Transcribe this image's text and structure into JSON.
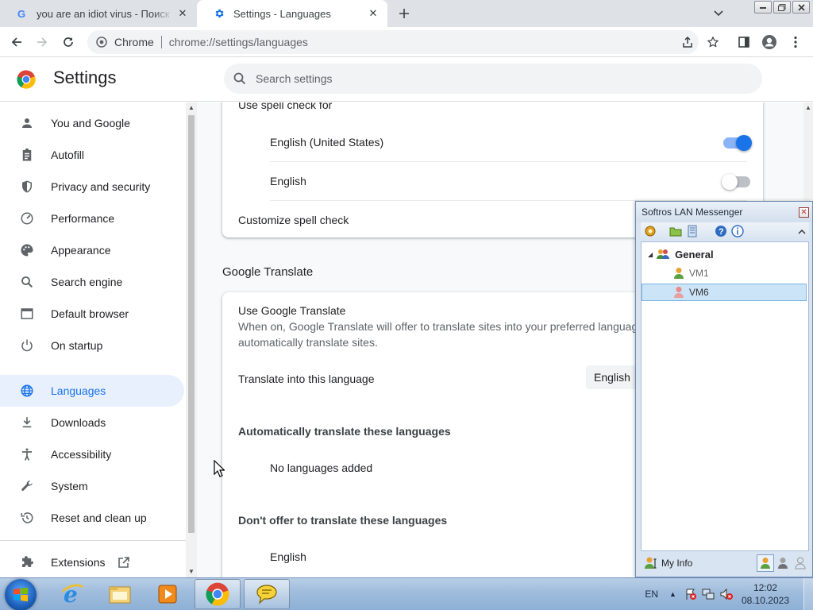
{
  "browser": {
    "tabs": [
      {
        "title": "you are an idiot virus - Поиск в Google",
        "favicon": "google-icon",
        "active": false
      },
      {
        "title": "Settings - Languages",
        "favicon": "gear-icon",
        "active": true
      }
    ],
    "omnibox": {
      "origin": "Chrome",
      "url": "chrome://settings/languages"
    }
  },
  "settings": {
    "title": "Settings",
    "search_placeholder": "Search settings",
    "nav": [
      {
        "label": "You and Google",
        "icon": "person-icon"
      },
      {
        "label": "Autofill",
        "icon": "clipboard-icon"
      },
      {
        "label": "Privacy and security",
        "icon": "shield-icon"
      },
      {
        "label": "Performance",
        "icon": "speedometer-icon"
      },
      {
        "label": "Appearance",
        "icon": "palette-icon"
      },
      {
        "label": "Search engine",
        "icon": "search-icon"
      },
      {
        "label": "Default browser",
        "icon": "browser-window-icon"
      },
      {
        "label": "On startup",
        "icon": "power-icon"
      },
      {
        "label": "Languages",
        "icon": "globe-icon",
        "active": true
      },
      {
        "label": "Downloads",
        "icon": "download-icon"
      },
      {
        "label": "Accessibility",
        "icon": "accessibility-icon"
      },
      {
        "label": "System",
        "icon": "wrench-icon"
      },
      {
        "label": "Reset and clean up",
        "icon": "restore-icon"
      }
    ],
    "extensions_label": "Extensions"
  },
  "spellcheck": {
    "header": "Use spell check for",
    "languages": [
      {
        "label": "English (United States)",
        "enabled": true
      },
      {
        "label": "English",
        "enabled": false
      }
    ],
    "customize_label": "Customize spell check"
  },
  "translate": {
    "section_title": "Google Translate",
    "use_title": "Use Google Translate",
    "use_desc_line1": "When on, Google Translate will offer to translate sites into your preferred language. It ca",
    "use_desc_line2": "automatically translate sites.",
    "target_label": "Translate into this language",
    "target_value": "English",
    "auto_title": "Automatically translate these languages",
    "auto_empty": "No languages added",
    "never_title": "Don't offer to translate these languages",
    "never_items": [
      "English"
    ]
  },
  "messenger": {
    "title": "Softros LAN Messenger",
    "group": "General",
    "users": [
      {
        "name": "VM1",
        "selected": false
      },
      {
        "name": "VM6",
        "selected": true
      }
    ],
    "my_info_label": "My Info"
  },
  "taskbar": {
    "language": "EN",
    "time": "12:02",
    "date": "08.10.2023"
  },
  "colors": {
    "accent": "#1a73e8",
    "active_nav_bg": "#e8f0fe",
    "taskbar": "#9fbcdc"
  }
}
